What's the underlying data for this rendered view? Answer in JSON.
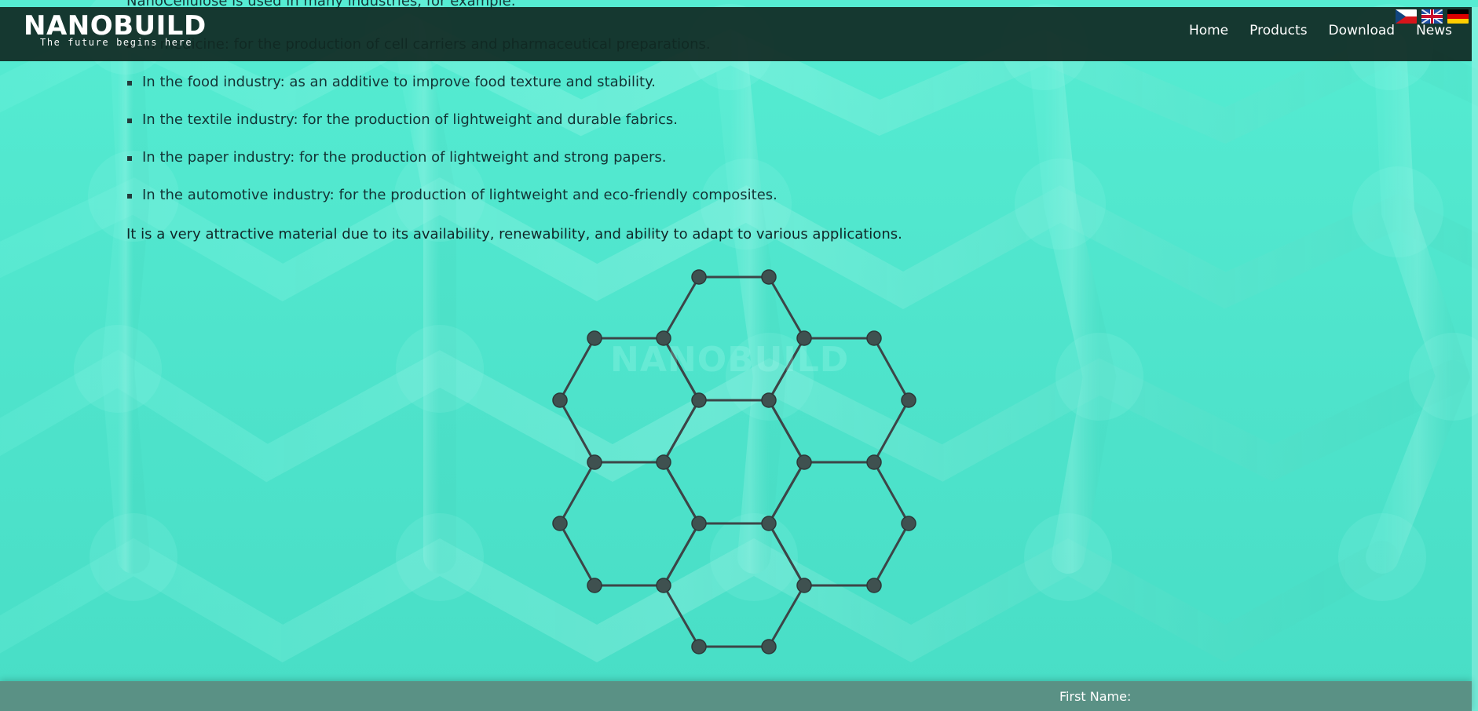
{
  "brand": {
    "title": "NANOBUILD",
    "tagline": "The future begins here"
  },
  "nav": {
    "home": "Home",
    "products": "Products",
    "download": "Download",
    "news": "News"
  },
  "flags": [
    {
      "name": "czech-flag"
    },
    {
      "name": "uk-flag"
    },
    {
      "name": "german-flag"
    }
  ],
  "content": {
    "intro": "NanoCellulose is used in many industries, for example:",
    "items": [
      "In medicine: for the production of cell carriers and pharmaceutical preparations.",
      "In the food industry: as an additive to improve food texture and stability.",
      "In the textile industry: for the production of lightweight and durable fabrics.",
      "In the paper industry: for the production of lightweight and strong papers.",
      "In the automotive industry: for the production of lightweight and eco-friendly composites."
    ],
    "summary": "It is a very attractive material due to its availability, renewability, and ability to adapt to various applications."
  },
  "diagram": {
    "watermark": "NANOBUILD"
  },
  "footer": {
    "first_name_label": "First Name:"
  },
  "colors": {
    "background": "#4fe6cc",
    "topbar": "#102822",
    "text": "#133435",
    "diagram": "#3c4547"
  }
}
